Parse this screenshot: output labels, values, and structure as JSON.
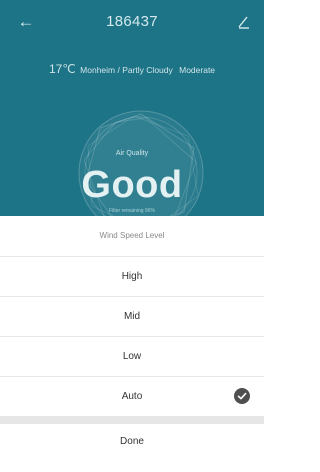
{
  "header": {
    "title": "186437",
    "back_icon": "arrow-left-icon",
    "edit_icon": "pencil-icon"
  },
  "weather": {
    "temperature": "17℃",
    "location_condition": "Monheim / Partly Cloudy",
    "air_level": "Moderate"
  },
  "air_quality": {
    "label": "Air Quality",
    "value": "Good",
    "filter_text": "Filter remaining 96%"
  },
  "wind_sheet": {
    "title": "Wind Speed Level",
    "options": [
      {
        "label": "High",
        "selected": false
      },
      {
        "label": "Mid",
        "selected": false
      },
      {
        "label": "Low",
        "selected": false
      },
      {
        "label": "Auto",
        "selected": true
      }
    ],
    "selected_icon": "checkmark-circle-icon",
    "done_label": "Done"
  },
  "colors": {
    "hero_background": "#1e7487",
    "check_badge": "#4f4f4f"
  }
}
